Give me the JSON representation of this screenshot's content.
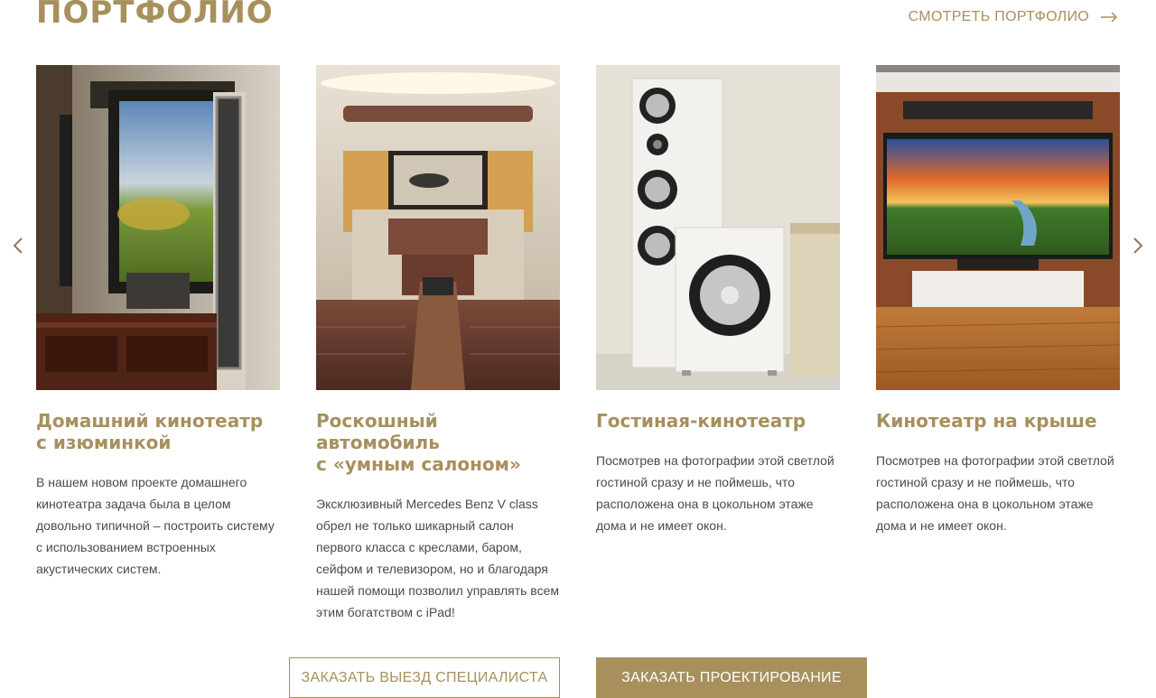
{
  "header": {
    "title": "ПОРТФОЛИО",
    "view_all_label": "СМОТРЕТЬ ПОРТФОЛИО"
  },
  "colors": {
    "accent": "#a7905c",
    "text": "#4a4a4a"
  },
  "carousel": {
    "prev_icon": "chevron-left-icon",
    "next_icon": "chevron-right-icon",
    "cards": [
      {
        "title": "Домашний кинотеатр\nс изюминкой",
        "text": "В нашем новом проекте домашнего\nкинотеатра задача была в целом\nдовольно типичной – построить систему\nс использованием встроенных\nакустических систем."
      },
      {
        "title": "Роскошный\nавтомобиль\nс «умным салоном»",
        "text": "Эксклюзивный Mercedes Benz V class\nобрел не только шикарный салон\nпервого класса с креслами, баром,\nсейфом и телевизором, но и благодаря\nнашей помощи позволил управлять всем\nэтим богатством с iPad!"
      },
      {
        "title": "Гостиная-кинотеатр",
        "text": "Посмотрев на фотографии этой светлой\nгостиной сразу и не поймешь, что\nрасположена она в цокольном этаже\nдома и не имеет окон."
      },
      {
        "title": "Кинотеатр на крыше",
        "text": "Посмотрев на фотографии этой светлой\nгостиной сразу и не поймешь, что\nрасположена она в цокольном этаже\nдома  и не имеет окон."
      }
    ]
  },
  "actions": {
    "order_visit_label": "ЗАКАЗАТЬ ВЫЕЗД СПЕЦИАЛИСТА",
    "order_design_label": "ЗАКАЗАТЬ ПРОЕКТИРОВАНИЕ"
  }
}
